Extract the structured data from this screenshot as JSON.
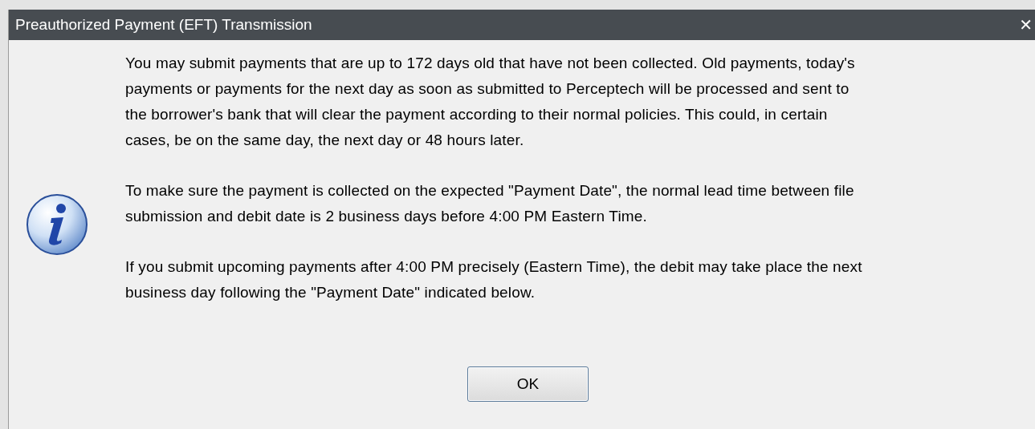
{
  "window": {
    "title": "Preauthorized Payment (EFT) Transmission",
    "close": "✕"
  },
  "paragraphs": [
    {
      "lines": [
        "You may submit payments that are up to 172 days old that have not been collected. Old payments, today's",
        "payments or payments for the next day as soon as submitted to Perceptech will be processed and sent to",
        "the borrower's bank that will clear the payment according to their normal policies. This could, in certain",
        "cases, be on the same day, the next day or 48 hours later."
      ]
    },
    {
      "lines": [
        "To make sure the payment is collected on the expected \"Payment Date\", the normal lead time between file",
        "submission and debit date is 2 business days before 4:00 PM Eastern Time."
      ]
    },
    {
      "lines": [
        "If you submit upcoming payments after 4:00 PM precisely (Eastern Time), the debit may take place the next",
        "business day following the \"Payment Date\" indicated below."
      ]
    }
  ],
  "buttons": [
    "OK"
  ]
}
